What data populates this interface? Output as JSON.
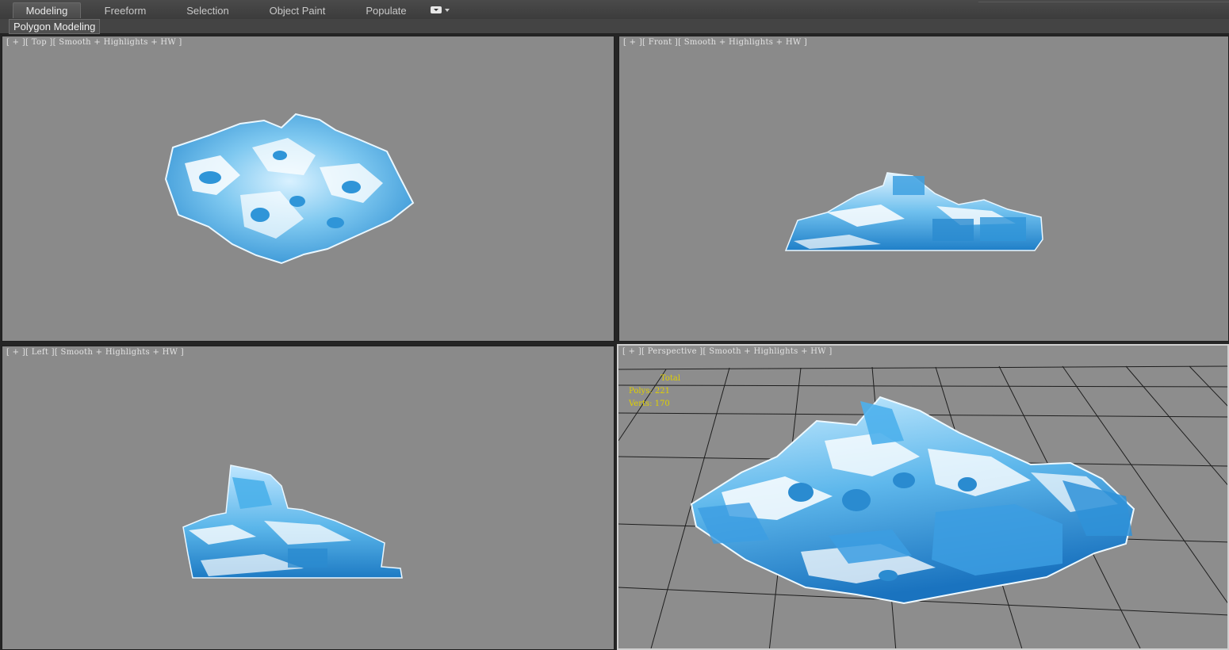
{
  "ribbon": {
    "tabs": [
      {
        "label": "Modeling",
        "active": true
      },
      {
        "label": "Freeform",
        "active": false
      },
      {
        "label": "Selection",
        "active": false
      },
      {
        "label": "Object Paint",
        "active": false
      },
      {
        "label": "Populate",
        "active": false
      }
    ],
    "options_icon": "ribbon-options-icon"
  },
  "panel": {
    "label": "Polygon Modeling"
  },
  "viewports": {
    "top": {
      "label": "[ + ][ Top ][ Smooth + Highlights + HW ]"
    },
    "front": {
      "label": "[ + ][ Front ][ Smooth + Highlights + HW ]"
    },
    "left": {
      "label": "[ + ][ Left ][ Smooth + Highlights + HW ]"
    },
    "perspective": {
      "label": "[ + ][ Perspective ][ Smooth + Highlights + HW ]",
      "active": true,
      "stats": {
        "total_label": "Total",
        "polys": "Polys: 221",
        "verts": "Verts: 170"
      }
    }
  },
  "colors": {
    "viewport_bg": "#8a8a8a",
    "ice_light": "#ffffff",
    "ice_mid": "#7ec8f0",
    "ice_dark": "#1f7fc8",
    "stats_text": "#e0d000",
    "active_border": "#cfcfcf"
  }
}
